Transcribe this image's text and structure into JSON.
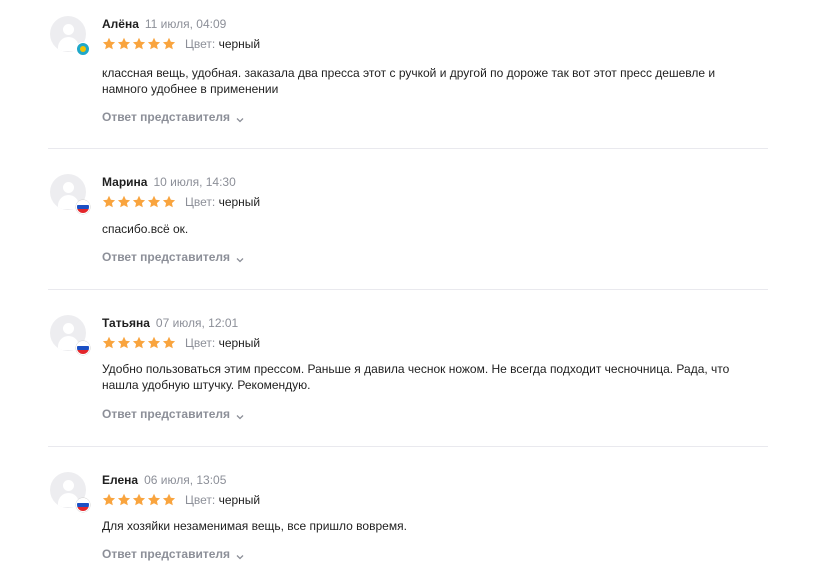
{
  "reviews": [
    {
      "author": "Алёна",
      "date": "11 июля, 04:09",
      "rating": 5,
      "variant_label": "Цвет:",
      "variant_value": "черный",
      "flag": "kz",
      "text": "классная вещь, удобная. заказала два пресса этот с ручкой и другой по дороже так вот этот пресс дешевле и намного удобнее в применении",
      "answer_label": "Ответ представителя"
    },
    {
      "author": "Марина",
      "date": "10 июля, 14:30",
      "rating": 5,
      "variant_label": "Цвет:",
      "variant_value": "черный",
      "flag": "ru",
      "text": "спасибо.всё ок.",
      "answer_label": "Ответ представителя"
    },
    {
      "author": "Татьяна",
      "date": "07 июля, 12:01",
      "rating": 5,
      "variant_label": "Цвет:",
      "variant_value": "черный",
      "flag": "ru",
      "text": "Удобно пользоваться этим прессом. Раньше я давила чеснок ножом. Не всегда подходит чесночница. Рада, что нашла удобную штучку. Рекомендую.",
      "answer_label": "Ответ представителя"
    },
    {
      "author": "Елена",
      "date": "06 июля, 13:05",
      "rating": 5,
      "variant_label": "Цвет:",
      "variant_value": "черный",
      "flag": "ru",
      "text": "Для хозяйки незаменимая вещь, все пришло вовремя.",
      "answer_label": "Ответ представителя"
    }
  ],
  "colors": {
    "star": "#f9a43e",
    "muted": "#8c8f98",
    "text": "#1f1f1f",
    "divider": "#e9e9ee"
  },
  "icons": {
    "avatar": "user-placeholder-icon",
    "star": "star-icon",
    "answer_toggle": "chevron-down-icon",
    "flag_kz": "kazakhstan-flag-icon",
    "flag_ru": "russia-flag-icon"
  }
}
